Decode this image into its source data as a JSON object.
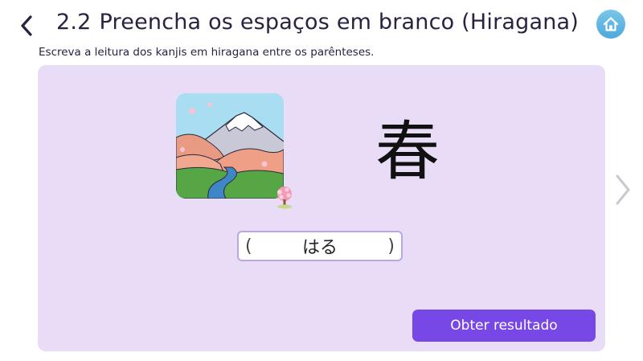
{
  "header": {
    "section_number": "2.2",
    "title": "Preencha os espaços em branco (Hiragana)",
    "back_icon": "chevron-left-icon",
    "home_icon": "home-icon"
  },
  "instruction": "Escreva a leitura dos kanjis em hiragana entre os parênteses.",
  "exercise": {
    "kanji": "春",
    "answer_value": "はる",
    "paren_open": "(",
    "paren_close": ")",
    "picture": "spring-mountain-illustration",
    "picture_badge": "cherry-blossom-icon"
  },
  "actions": {
    "submit_label": "Obter resultado",
    "next_icon": "chevron-right-icon"
  },
  "colors": {
    "card_background": "#e8dcf7",
    "primary_button": "#7748e6",
    "input_border": "#b9a6e4",
    "home_button": "#5bb3e2"
  }
}
